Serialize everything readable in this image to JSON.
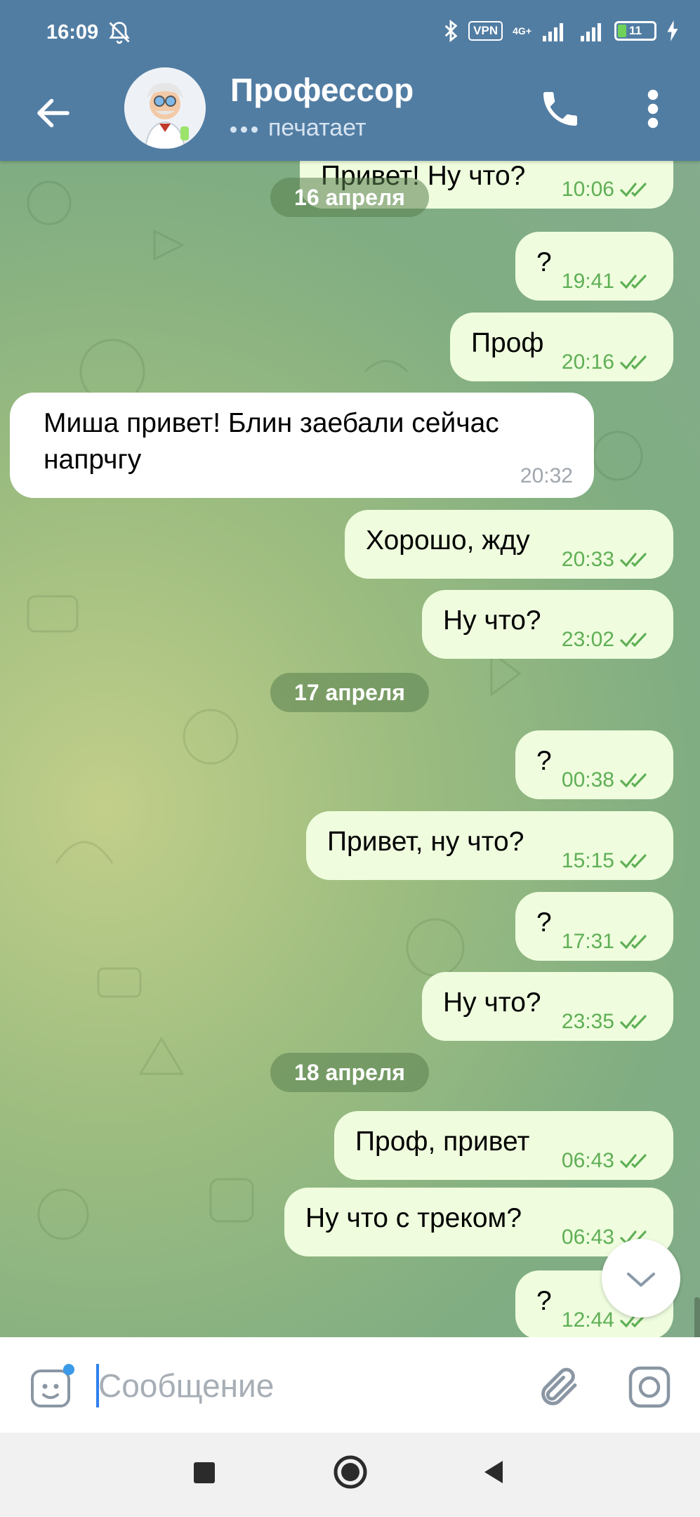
{
  "status_bar": {
    "time": "16:09",
    "vpn_label": "VPN",
    "network": "4G+",
    "battery": "11"
  },
  "header": {
    "title": "Профессор",
    "subtitle": "печатает"
  },
  "dates": [
    "16 апреля",
    "17 апреля",
    "18 апреля"
  ],
  "messages": [
    {
      "text": "Привет! Ну что?",
      "time": "10:06",
      "direction": "out"
    },
    {
      "text": "?",
      "time": "19:41",
      "direction": "out"
    },
    {
      "text": "Проф",
      "time": "20:16",
      "direction": "out"
    },
    {
      "text_line1": "Миша привет! Блин заебали сейчас",
      "text_line2": "напрчгу",
      "time": "20:32",
      "direction": "in"
    },
    {
      "text": "Хорошо, жду",
      "time": "20:33",
      "direction": "out"
    },
    {
      "text": "Ну что?",
      "time": "23:02",
      "direction": "out"
    },
    {
      "text": "?",
      "time": "00:38",
      "direction": "out"
    },
    {
      "text": "Привет, ну что?",
      "time": "15:15",
      "direction": "out"
    },
    {
      "text": "?",
      "time": "17:31",
      "direction": "out"
    },
    {
      "text": "Ну что?",
      "time": "23:35",
      "direction": "out"
    },
    {
      "text": "Проф, привет",
      "time": "06:43",
      "direction": "out"
    },
    {
      "text": "Ну что с треком?",
      "time": "06:43",
      "direction": "out"
    },
    {
      "text": "?",
      "time": "12:44",
      "direction": "out"
    }
  ],
  "input": {
    "placeholder": "Сообщение"
  },
  "colors": {
    "header_bg": "#527da3",
    "outgoing_bubble": "#effdde",
    "incoming_bubble": "#ffffff",
    "read_check": "#5faf55"
  }
}
